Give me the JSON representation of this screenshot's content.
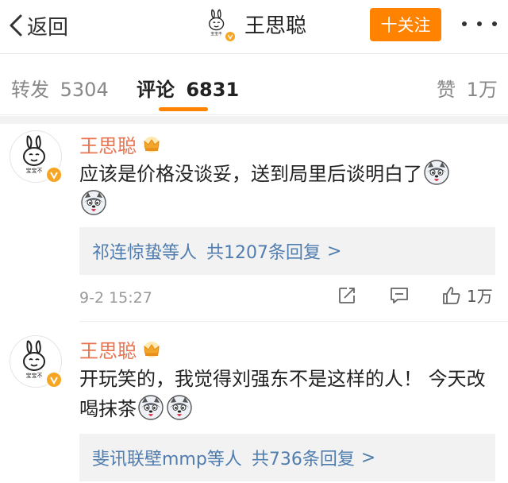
{
  "nav": {
    "back_label": "返回",
    "title": "王思聪",
    "follow_label": "十关注"
  },
  "tabs": {
    "repost_label": "转发",
    "repost_count": "5304",
    "comment_label": "评论",
    "comment_count": "6831",
    "like_label": "赞",
    "like_count": "1万"
  },
  "colors": {
    "accent": "#ff8200",
    "username": "#eb7350",
    "link": "#507daf",
    "verified": "#f6a623"
  },
  "comments": [
    {
      "user": "王思聪",
      "text": "应该是价格没谈妥，送到局里后谈明白了",
      "emoji_count": 2,
      "reply_users": "祁连惊蛰",
      "reply_mid": "等人",
      "reply_count": "共1207条回复",
      "reply_arrow": ">",
      "time": "9-2 15:27",
      "likes": "1万"
    },
    {
      "user": "王思聪",
      "text": "开玩笑的，我觉得刘强东不是这样的人！ 今天改喝抹茶",
      "emoji_count": 2,
      "reply_users": "斐讯联壁mmp",
      "reply_mid": "等人",
      "reply_count": "共736条回复",
      "reply_arrow": ">"
    }
  ],
  "icons": [
    "chevron-left-icon",
    "more-icon",
    "crown-icon",
    "verified-icon",
    "husky-emoji-icon",
    "share-icon",
    "comment-icon",
    "like-icon"
  ]
}
